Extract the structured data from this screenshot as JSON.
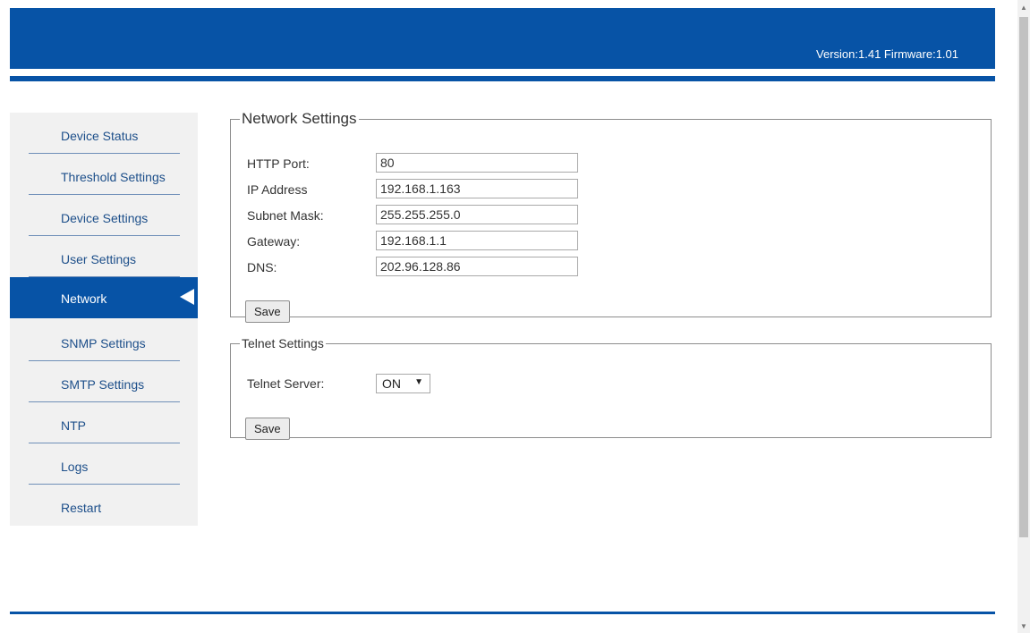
{
  "header": {
    "version_text": "Version:1.41 Firmware:1.01",
    "brand_color": "#0753a6"
  },
  "sidebar": {
    "items": [
      {
        "label": "Device Status",
        "active": false
      },
      {
        "label": "Threshold Settings",
        "active": false
      },
      {
        "label": "Device Settings",
        "active": false
      },
      {
        "label": "User Settings",
        "active": false
      },
      {
        "label": "Network",
        "active": true
      },
      {
        "label": "SNMP Settings",
        "active": false
      },
      {
        "label": "SMTP Settings",
        "active": false
      },
      {
        "label": "NTP",
        "active": false
      },
      {
        "label": "Logs",
        "active": false
      },
      {
        "label": "Restart",
        "active": false
      }
    ]
  },
  "network": {
    "legend": "Network Settings",
    "fields": [
      {
        "label": "HTTP Port:",
        "value": "80"
      },
      {
        "label": "IP Address",
        "value": "192.168.1.163"
      },
      {
        "label": "Subnet Mask:",
        "value": "255.255.255.0"
      },
      {
        "label": "Gateway:",
        "value": "192.168.1.1"
      },
      {
        "label": "DNS:",
        "value": "202.96.128.86"
      }
    ],
    "save_label": "Save"
  },
  "telnet": {
    "legend": "Telnet Settings",
    "server_label": "Telnet Server:",
    "server_value": "ON",
    "save_label": "Save"
  },
  "icons": {
    "active_indicator": "caret-left-icon",
    "select_caret": "chevron-down-icon"
  }
}
